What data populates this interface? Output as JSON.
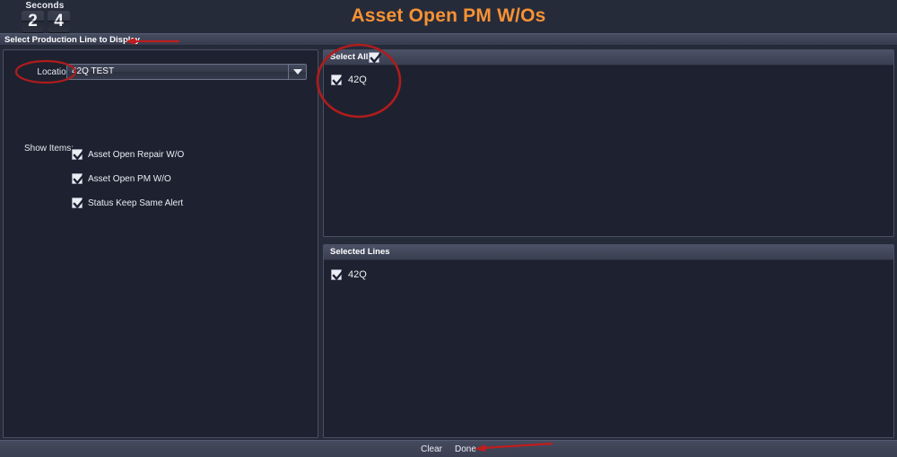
{
  "header": {
    "clock_label": "Seconds",
    "digits": [
      "2",
      "4"
    ],
    "title": "Asset Open PM W/Os"
  },
  "section": {
    "title": "Select Production Line to Display"
  },
  "left_panel": {
    "location_label": "Location:",
    "location_value": "42Q TEST",
    "location_placeholder": "42Q TEST",
    "dropdown_icon": "chevron-down-icon",
    "show_items_label": "Show Items:",
    "show_items": [
      {
        "label": "Asset Open Repair W/O",
        "checked": true
      },
      {
        "label": "Asset Open PM W/O",
        "checked": true
      },
      {
        "label": "Status Keep Same Alert",
        "checked": true
      }
    ]
  },
  "available_lines": {
    "select_all_label": "Select All:",
    "select_all_checked": true,
    "items": [
      {
        "label": "42Q",
        "checked": true
      }
    ]
  },
  "selected_lines": {
    "title": "Selected Lines",
    "items": [
      {
        "label": "42Q",
        "checked": true
      }
    ]
  },
  "footer": {
    "clear_label": "Clear",
    "done_label": "Done"
  },
  "annotations": {
    "color": "#b01c1c",
    "shapes": [
      {
        "type": "ellipse",
        "target": "location-label"
      },
      {
        "type": "ellipse",
        "target": "select-all-and-line"
      },
      {
        "type": "arrow",
        "target": "section-title"
      },
      {
        "type": "arrow",
        "target": "done-button"
      }
    ]
  },
  "colors": {
    "background": "#262b3a",
    "panel": "#1e2230",
    "panel_border": "#4a5064",
    "bar": "#414759",
    "accent_title": "#f79233",
    "annotation": "#b01c1c",
    "text": "#e9ecf3"
  }
}
